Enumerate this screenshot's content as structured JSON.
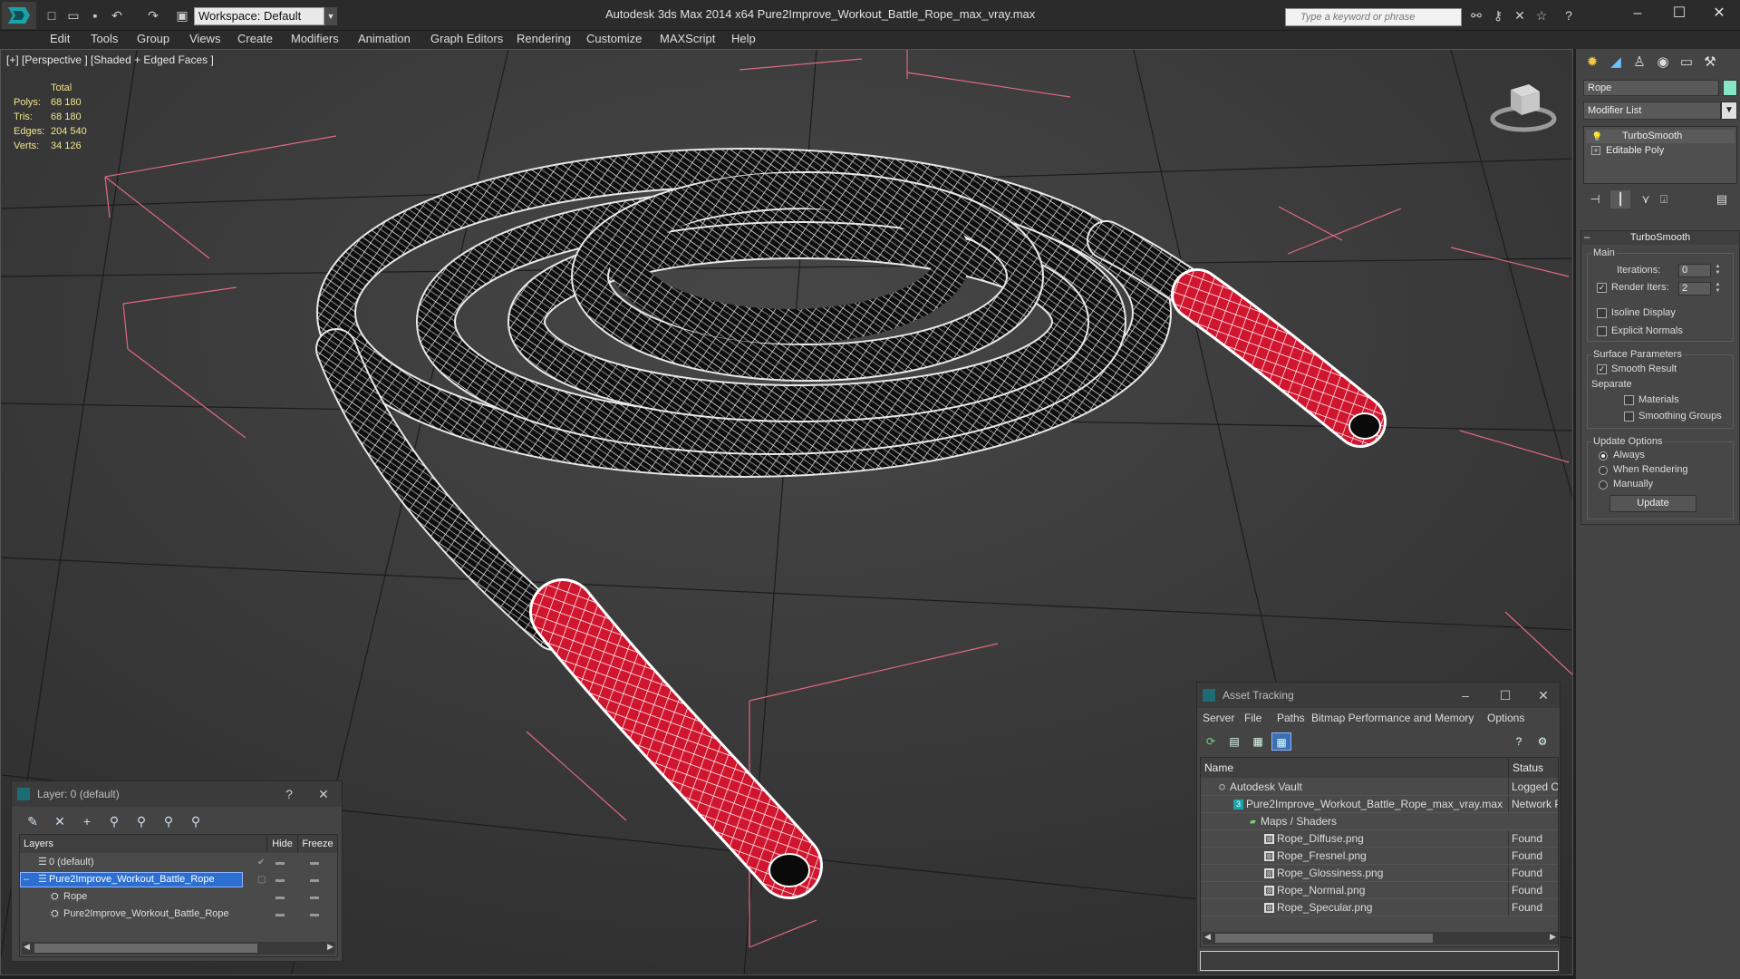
{
  "app": {
    "title": "Autodesk 3ds Max  2014 x64      Pure2Improve_Workout_Battle_Rope_max_vray.max",
    "workspace": "Workspace: Default",
    "search_placeholder": "Type a keyword or phrase"
  },
  "menu": [
    "Edit",
    "Tools",
    "Group",
    "Views",
    "Create",
    "Modifiers",
    "Animation",
    "Graph Editors",
    "Rendering",
    "Customize",
    "MAXScript",
    "Help"
  ],
  "viewport": {
    "label": "[+] [Perspective ] [Shaded + Edged Faces ]",
    "stats": {
      "header": "Total",
      "rows": [
        {
          "key": "Polys:",
          "value": "68 180"
        },
        {
          "key": "Tris:",
          "value": "68 180"
        },
        {
          "key": "Edges:",
          "value": "204 540"
        },
        {
          "key": "Verts:",
          "value": "34 126"
        }
      ]
    }
  },
  "command_panel": {
    "object_name": "Rope",
    "object_color": "#86e6c6",
    "modifier_list": "Modifier List",
    "stack": [
      "TurboSmooth",
      "Editable Poly"
    ],
    "rollout_title": "TurboSmooth",
    "main_group": "Main",
    "iterations_label": "Iterations:",
    "iterations_value": "0",
    "render_iters_label": "Render Iters:",
    "render_iters_value": "2",
    "isoline_display": "Isoline Display",
    "explicit_normals": "Explicit Normals",
    "surface_group": "Surface Parameters",
    "smooth_result": "Smooth Result",
    "separate_label": "Separate",
    "materials": "Materials",
    "smoothing_groups": "Smoothing Groups",
    "update_group": "Update Options",
    "always": "Always",
    "when_rendering": "When Rendering",
    "manually": "Manually",
    "update_button": "Update"
  },
  "layer_window": {
    "title": "Layer: 0 (default)",
    "help": "?",
    "close": "✕",
    "headers": {
      "layers": "Layers",
      "hide": "Hide",
      "freeze": "Freeze"
    },
    "rows": [
      {
        "name": "0 (default)"
      },
      {
        "name": "Pure2Improve_Workout_Battle_Rope"
      },
      {
        "name": "Rope"
      },
      {
        "name": "Pure2Improve_Workout_Battle_Rope"
      }
    ]
  },
  "asset_window": {
    "title": "Asset Tracking",
    "menu": [
      "Server",
      "File",
      "Paths",
      "Bitmap Performance and Memory",
      "Options"
    ],
    "headers": {
      "name": "Name",
      "status": "Status"
    },
    "rows": [
      {
        "name": "Autodesk Vault",
        "status": "Logged Out"
      },
      {
        "name": "Pure2Improve_Workout_Battle_Rope_max_vray.max",
        "status": "Network Path"
      },
      {
        "name": "Maps / Shaders",
        "status": ""
      },
      {
        "name": "Rope_Diffuse.png",
        "status": "Found"
      },
      {
        "name": "Rope_Fresnel.png",
        "status": "Found"
      },
      {
        "name": "Rope_Glossiness.png",
        "status": "Found"
      },
      {
        "name": "Rope_Normal.png",
        "status": "Found"
      },
      {
        "name": "Rope_Specular.png",
        "status": "Found"
      }
    ]
  }
}
